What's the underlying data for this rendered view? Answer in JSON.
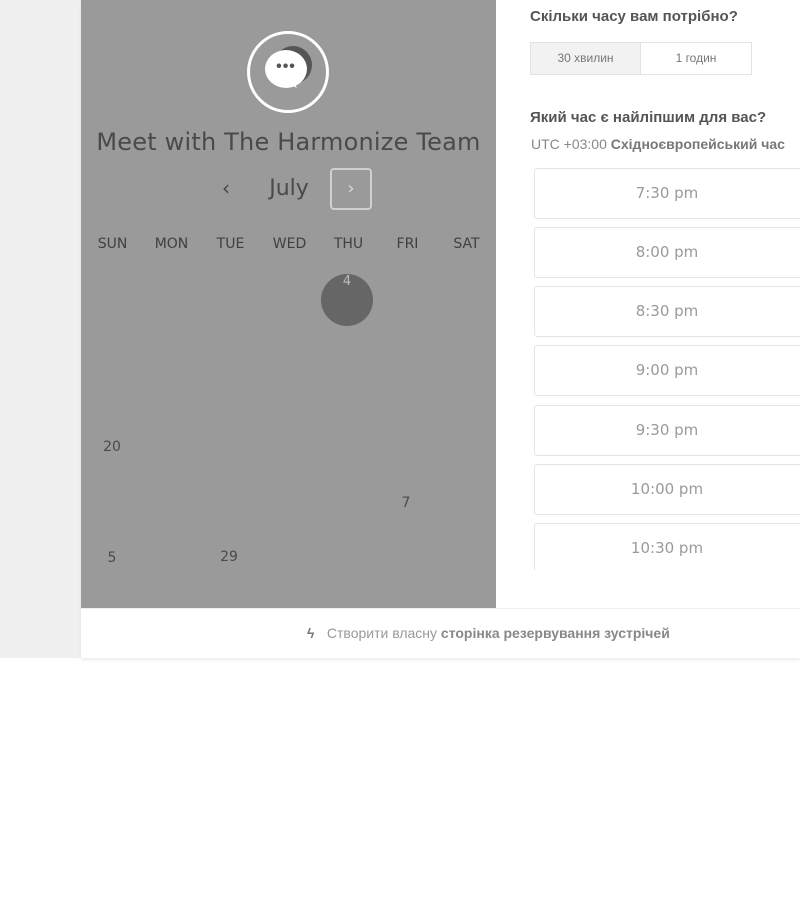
{
  "calendar": {
    "title": "Meet with The Harmonize Team",
    "month": "July",
    "prev_icon": "chevron-left-icon",
    "next_icon": "chevron-right-icon",
    "weekdays": [
      "SUN",
      "MON",
      "TUE",
      "WED",
      "THU",
      "FRI",
      "SAT"
    ],
    "selected_day": "4",
    "days": [
      "20",
      "7",
      "5",
      "29"
    ]
  },
  "booking": {
    "duration_question": "Скільки часу вам потрібно?",
    "durations": [
      "30 хвилин",
      "1 годин"
    ],
    "time_question": "Який час є найліпшим для вас?",
    "timezone_offset": "UTC +03:00",
    "timezone_name": "Східноєвропейський час",
    "slots": [
      "7:30 pm",
      "8:00 pm",
      "8:30 pm",
      "9:00 pm",
      "9:30 pm",
      "10:00 pm",
      "10:30 pm"
    ]
  },
  "footer": {
    "icon": "hubspot-sprocket-icon",
    "text_prefix": "Створити власну",
    "text_bold": "сторінка резервування зустрічей"
  },
  "colors": {
    "overlay": "#9a9a9a",
    "selected_day": "#666666",
    "page_background": "#ffffff"
  }
}
